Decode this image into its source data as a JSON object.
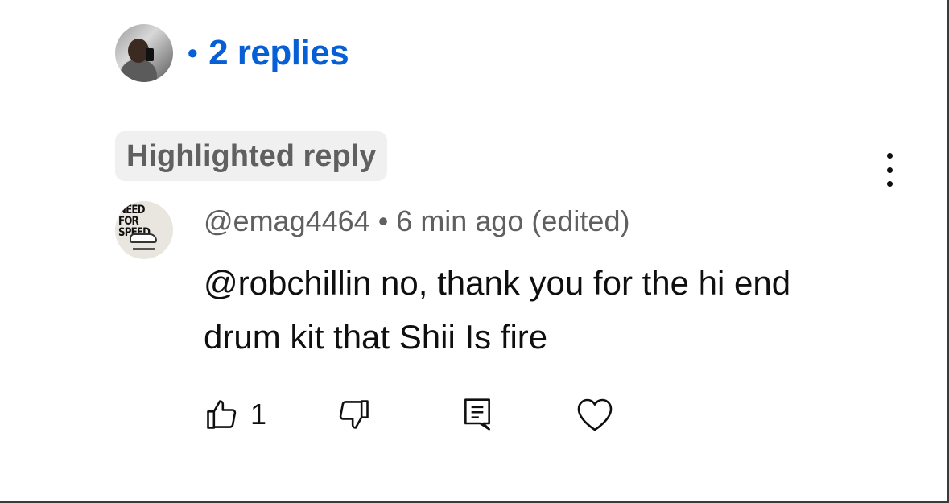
{
  "replies": {
    "count_label": "2 replies",
    "dot": "•"
  },
  "highlight_chip": "Highlighted reply",
  "comment": {
    "author": "@emag4464",
    "separator": "•",
    "time": "6 min ago (edited)",
    "mention": "@robchillin",
    "text": " no, thank you for the hi end drum kit that Shii Is fire"
  },
  "actions": {
    "like_count": "1"
  },
  "icons": {
    "like": "thumbs-up-icon",
    "dislike": "thumbs-down-icon",
    "reply": "comment-icon",
    "heart": "heart-icon",
    "more": "more-vertical-icon"
  },
  "colors": {
    "link": "#065fd4",
    "muted": "#606060",
    "chip_bg": "#f0f0f0"
  }
}
